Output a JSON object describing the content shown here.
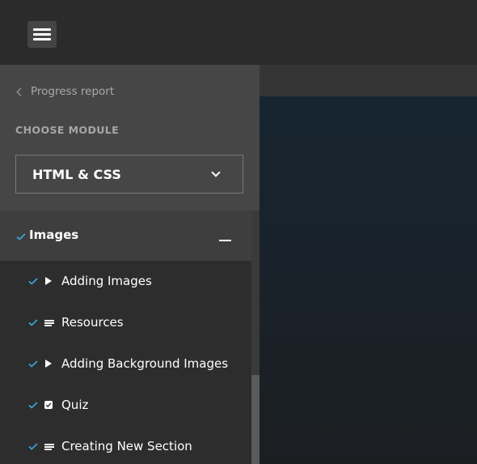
{
  "header": {
    "menu_icon": "hamburger-menu-icon"
  },
  "sidebar": {
    "back_link": {
      "label": "Progress report",
      "icon": "chevron-left-icon"
    },
    "choose_module_label": "CHOOSE MODULE",
    "module_select": {
      "value": "HTML & CSS",
      "icon": "chevron-down-icon"
    },
    "section": {
      "title": "Images",
      "completed": true,
      "expanded": true,
      "toggle_icon": "minus-icon"
    },
    "lessons": [
      {
        "label": "Adding Images",
        "type": "video",
        "icon": "play-icon",
        "completed": true
      },
      {
        "label": "Resources",
        "type": "text",
        "icon": "text-lines-icon",
        "completed": true
      },
      {
        "label": "Adding Background Images",
        "type": "video",
        "icon": "play-icon",
        "completed": true
      },
      {
        "label": "Quiz",
        "type": "quiz",
        "icon": "quiz-check-icon",
        "completed": true
      },
      {
        "label": "Creating New Section",
        "type": "text",
        "icon": "text-lines-icon",
        "completed": true
      }
    ]
  },
  "colors": {
    "accent_check": "#3aa6dd",
    "sidebar_header_bg": "#464646",
    "section_header_bg": "#3e3e3e",
    "sidebar_bg": "#2d2d2d",
    "topbar_bg": "#2b2b2b"
  }
}
